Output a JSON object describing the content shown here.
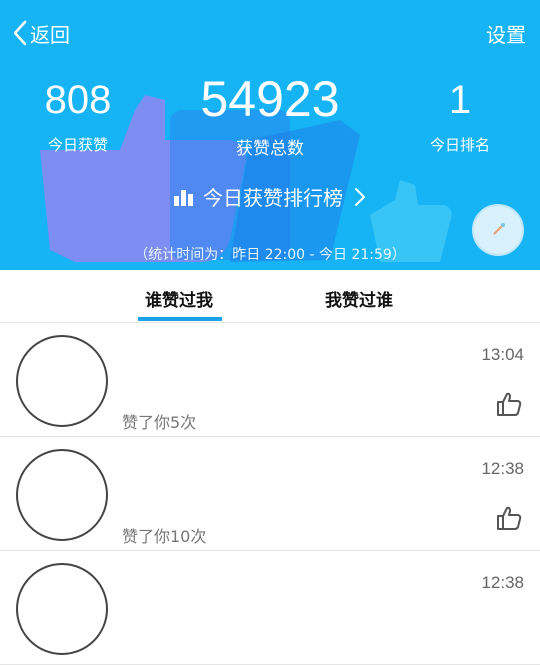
{
  "topbar": {
    "back_label": "返回",
    "settings_label": "设置"
  },
  "stats": [
    {
      "value": "808",
      "label": "今日获赞"
    },
    {
      "value": "54923",
      "label": "获赞总数"
    },
    {
      "value": "1",
      "label": "今日排名"
    }
  ],
  "ranking_link": {
    "label": "今日获赞排行榜"
  },
  "stat_period": "（统计时间为：昨日 22:00 - 今日 21:59）",
  "tabs": [
    {
      "label": "谁赞过我",
      "active": true
    },
    {
      "label": "我赞过谁",
      "active": false
    }
  ],
  "likes": [
    {
      "time": "13:04",
      "text": "赞了你5次"
    },
    {
      "time": "12:38",
      "text": "赞了你10次"
    },
    {
      "time": "12:38",
      "text": ""
    }
  ],
  "colors": {
    "hero_bg": "#16b4f4",
    "accent": "#1aa0e8"
  },
  "icons": {
    "back": "chevron-left-icon",
    "ranking": "bar-chart-icon",
    "ranking_arrow": "chevron-right-icon",
    "like": "thumbs-up-icon"
  }
}
